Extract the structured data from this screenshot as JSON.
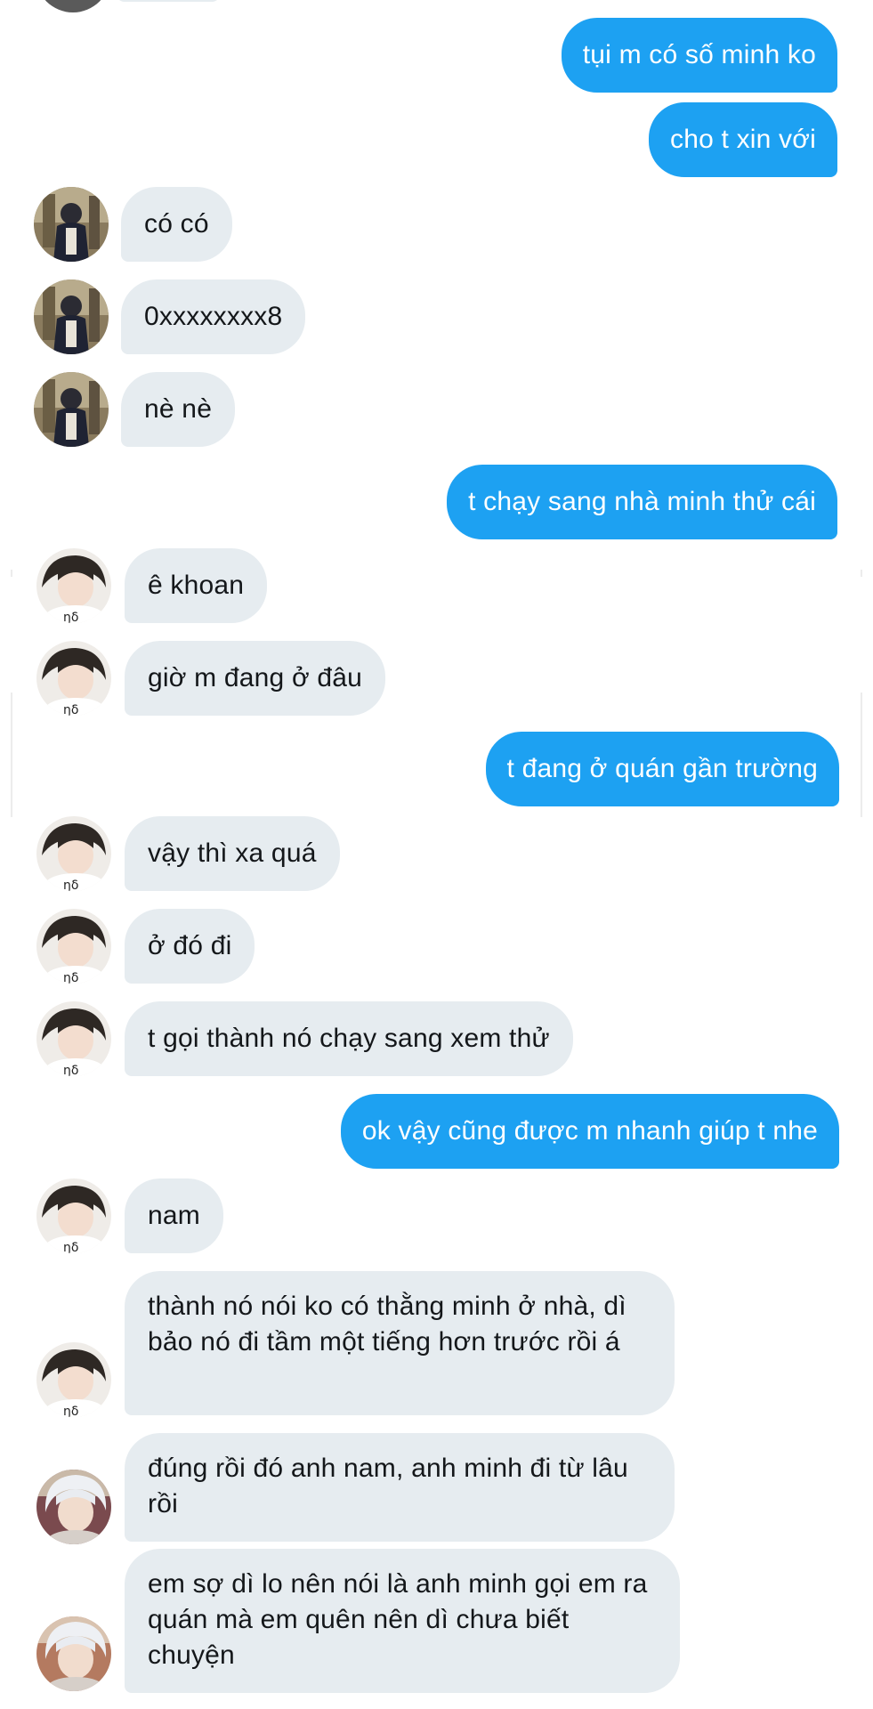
{
  "conversation": {
    "messages": [
      {
        "side": "out",
        "text": "tụi m có số minh ko"
      },
      {
        "side": "out",
        "text": "cho t xin với"
      },
      {
        "side": "in",
        "avatar": "avatar-1",
        "text": "có có"
      },
      {
        "side": "in",
        "avatar": "avatar-1",
        "text": "0xxxxxxxx8"
      },
      {
        "side": "in",
        "avatar": "avatar-1",
        "text": "nè nè"
      },
      {
        "side": "out",
        "text": "t chạy sang nhà minh thử cái"
      },
      {
        "side": "in",
        "avatar": "avatar-2",
        "text": "ê khoan"
      },
      {
        "side": "in",
        "avatar": "avatar-2",
        "text": "giờ m đang ở đâu"
      },
      {
        "side": "out",
        "text": "t đang ở quán gần trường"
      },
      {
        "side": "in",
        "avatar": "avatar-2",
        "text": "vậy thì xa quá"
      },
      {
        "side": "in",
        "avatar": "avatar-2",
        "text": "ở đó đi"
      },
      {
        "side": "in",
        "avatar": "avatar-2",
        "text": "t gọi thành nó chạy sang xem thử"
      },
      {
        "side": "out",
        "text": "ok vậy cũng được m nhanh giúp t nhe"
      },
      {
        "side": "in",
        "avatar": "avatar-2",
        "text": "nam"
      },
      {
        "side": "in",
        "avatar": "avatar-2",
        "text": "thành nó nói ko có thằng minh ở nhà, dì bảo nó đi tầm một tiếng hơn trước rồi á"
      },
      {
        "side": "in",
        "avatar": "avatar-3",
        "text": "đúng rồi đó anh nam, anh minh đi từ lâu rồi"
      },
      {
        "side": "in",
        "avatar": "avatar-3",
        "text": "em sợ dì lo nên nói là anh minh gọi em ra quán mà em quên nên dì chưa biết chuyện"
      }
    ]
  },
  "colors": {
    "outgoing_bubble": "#1da1f2",
    "incoming_bubble": "#e6ecf0",
    "outgoing_text": "#ffffff",
    "incoming_text": "#14171a"
  }
}
